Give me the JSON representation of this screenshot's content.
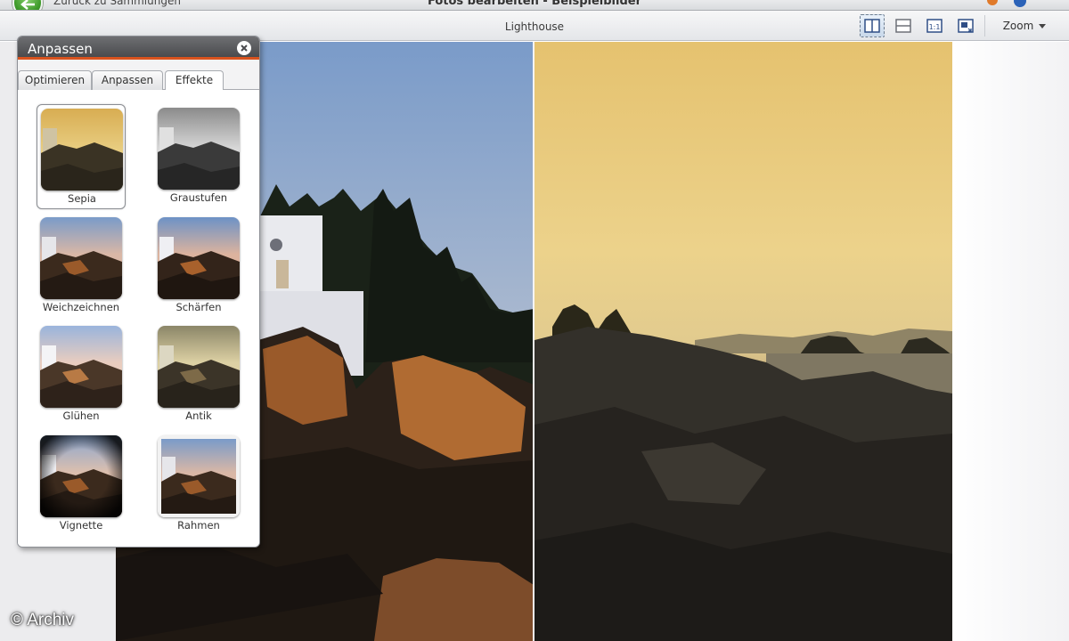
{
  "window": {
    "title": "Fotos bearbeiten - Beispielbilder",
    "back_label": "Zurück zu Sammlungen"
  },
  "toolbar": {
    "photo_name": "Lighthouse",
    "zoom_label": "Zoom",
    "buttons": [
      {
        "name": "side-by-side-view",
        "icon": "split-vertical-icon",
        "active": true
      },
      {
        "name": "before-after-view",
        "icon": "split-horizontal-icon",
        "active": false
      },
      {
        "name": "actual-size",
        "icon": "one-to-one-icon",
        "active": false
      },
      {
        "name": "fit-to-window",
        "icon": "fit-window-icon",
        "active": false
      }
    ]
  },
  "panel": {
    "title": "Anpassen",
    "tabs": [
      {
        "label": "Optimieren",
        "active": false
      },
      {
        "label": "Anpassen",
        "active": false
      },
      {
        "label": "Effekte",
        "active": true
      }
    ],
    "effects": [
      {
        "label": "Sepia",
        "selected": true
      },
      {
        "label": "Graustufen",
        "selected": false
      },
      {
        "label": "Weichzeichnen",
        "selected": false
      },
      {
        "label": "Schärfen",
        "selected": false
      },
      {
        "label": "Glühen",
        "selected": false
      },
      {
        "label": "Antik",
        "selected": false
      },
      {
        "label": "Vignette",
        "selected": false
      },
      {
        "label": "Rahmen",
        "selected": false
      }
    ]
  },
  "watermark": "© Archiv",
  "colors": {
    "panel_accent": "#d9531e",
    "panel_header": "#4a4b4e",
    "back_button": "#3f9b2b"
  }
}
